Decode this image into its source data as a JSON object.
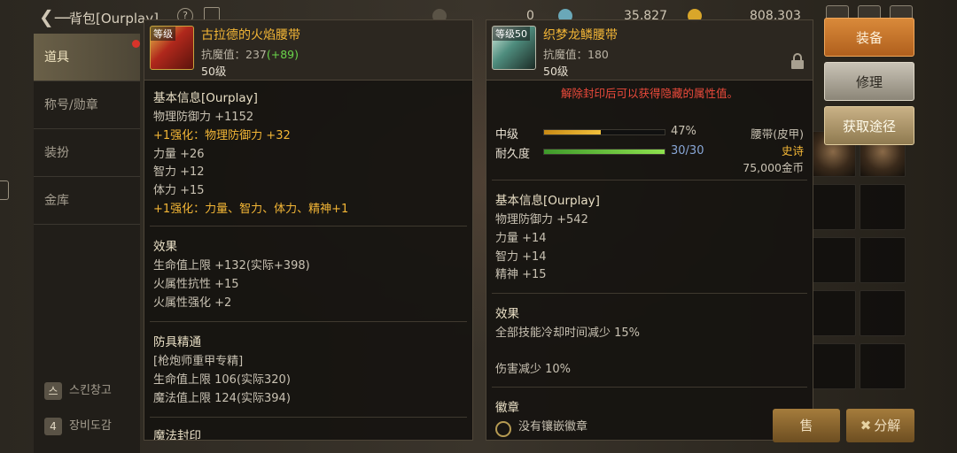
{
  "topbar": {
    "title": "背包[Ourplay]",
    "help_label": "?",
    "currency_1": "0",
    "currency_2": "35,827",
    "currency_3": "808,303"
  },
  "sidebar": {
    "items": [
      {
        "label": "道具"
      },
      {
        "label": "称号/勋章"
      },
      {
        "label": "装扮"
      },
      {
        "label": "金库"
      }
    ],
    "bottom": [
      {
        "icon": "스",
        "label": "스킨창고"
      },
      {
        "icon": "4",
        "label": "장비도감"
      }
    ]
  },
  "left_item": {
    "level_tag": "等级",
    "name": "古拉德的火焰腰带",
    "magic_resist_label": "抗魔值：237",
    "magic_resist_bonus": "(+89)",
    "level": "50级",
    "basic": {
      "title": "基本信息[Ourplay]",
      "lines": [
        {
          "text": "物理防御力 +1152",
          "style": "normal"
        },
        {
          "text": "+1强化：物理防御力 +32",
          "style": "orange"
        },
        {
          "text": "力量 +26",
          "style": "normal"
        },
        {
          "text": "智力 +12",
          "style": "normal"
        },
        {
          "text": "体力 +15",
          "style": "normal"
        },
        {
          "text": "+1强化：力量、智力、体力、精神+1",
          "style": "orange"
        }
      ]
    },
    "effect": {
      "title": "效果",
      "lines": [
        "生命值上限 +132(实际+398)",
        "火属性抗性 +15",
        "火属性强化 +2"
      ]
    },
    "mastery": {
      "title": "防具精通",
      "lines": [
        "[枪炮师重甲专精]",
        "生命值上限 106(实际320)",
        "魔法值上限 124(实际394)"
      ]
    },
    "next_title": "魔法封印"
  },
  "right_item": {
    "level_tag": "等级50",
    "name": "织梦龙鳞腰带",
    "magic_resist_label": "抗魔值：180",
    "level": "50级",
    "warning": "解除封印后可以获得隐藏的属性值。",
    "grade_label": "中级",
    "grade_value": "47%",
    "grade_ratio": 0.47,
    "durability_label": "耐久度",
    "durability_value": "30/30",
    "durability_ratio": 1.0,
    "type": "腰带(皮甲)",
    "rarity": "史诗",
    "price": "75,000金币",
    "basic": {
      "title": "基本信息[Ourplay]",
      "lines": [
        "物理防御力 +542",
        "力量 +14",
        "智力 +14",
        "精神 +15"
      ]
    },
    "effect": {
      "title": "效果",
      "line1": "全部技能冷却时间减少 15%",
      "line2": "伤害减少 10%"
    },
    "emblem": {
      "title": "徽章",
      "line": "没有镶嵌徽章"
    }
  },
  "buttons": {
    "equip": "装备",
    "repair": "修理",
    "source": "获取途径",
    "sell": "售",
    "decompose": "分解"
  },
  "colors": {
    "accent_orange": "#f3b636",
    "positive_green": "#6ad44a",
    "warning_red": "#ec4a3b",
    "equip_button": "#d98a3a"
  }
}
